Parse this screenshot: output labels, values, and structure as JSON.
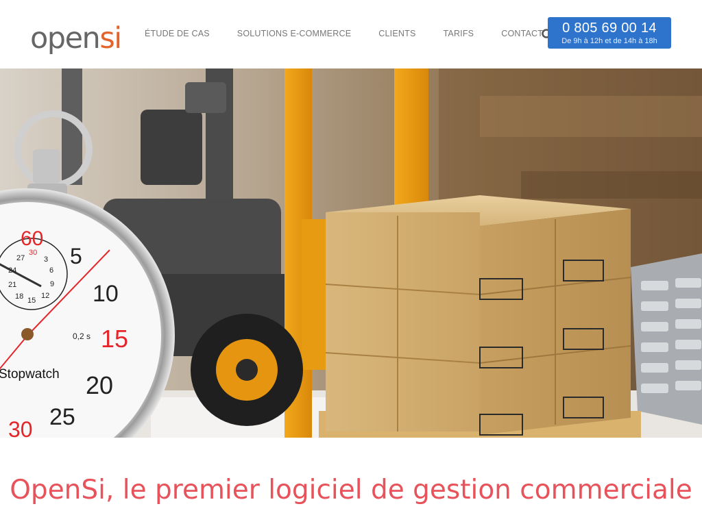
{
  "brand": {
    "logo_part1": "open",
    "logo_part2": "si"
  },
  "nav": {
    "items": [
      {
        "label": "ÉTUDE DE CAS"
      },
      {
        "label": "SOLUTIONS E-COMMERCE"
      },
      {
        "label": "CLIENTS"
      },
      {
        "label": "TARIFS"
      },
      {
        "label": "CONTACT"
      }
    ]
  },
  "search": {
    "icon": "search-icon"
  },
  "phone": {
    "number": "0 805 69 00 14",
    "hours": "De 9h à 12h et de 14h à 18h"
  },
  "hero": {
    "stopwatch_brand": "Stopwatch",
    "dial_numbers": [
      "60",
      "5",
      "10",
      "15",
      "20",
      "25",
      "30"
    ],
    "subdial_numbers": [
      "30",
      "27",
      "3",
      "6",
      "9",
      "12",
      "15",
      "18",
      "21",
      "24"
    ],
    "dial_unit": "0,2 s"
  },
  "headline": {
    "text": "OpenSi, le premier logiciel de gestion commerciale"
  },
  "colors": {
    "accent": "#e2632b",
    "phone_bg": "#2e74cc",
    "headline": "#e8525a",
    "nav_text": "#777777"
  }
}
